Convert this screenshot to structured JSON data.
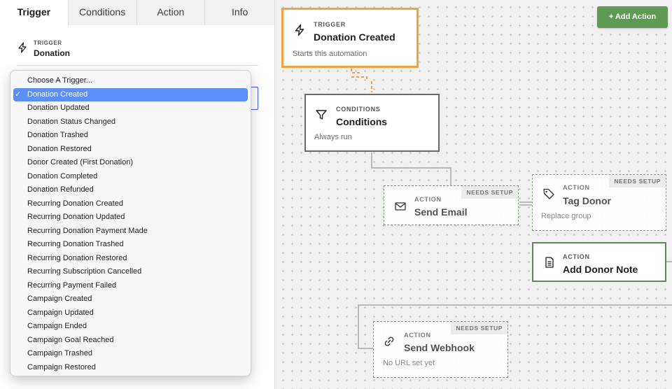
{
  "tabs": [
    {
      "label": "Trigger",
      "active": true
    },
    {
      "label": "Conditions",
      "active": false
    },
    {
      "label": "Action",
      "active": false
    },
    {
      "label": "Info",
      "active": false
    }
  ],
  "trigger_panel": {
    "kicker": "TRIGGER",
    "title": "Donation"
  },
  "dropdown": {
    "selected": "Donation Created",
    "options": [
      "Choose A Trigger...",
      "Donation Created",
      "Donation Updated",
      "Donation Status Changed",
      "Donation Trashed",
      "Donation Restored",
      "Donor Created (First Donation)",
      "Donation Completed",
      "Donation Refunded",
      "Recurring Donation Created",
      "Recurring Donation Updated",
      "Recurring Donation Payment Made",
      "Recurring Donation Trashed",
      "Recurring Donation Restored",
      "Recurring Subscription Cancelled",
      "Recurring Payment Failed",
      "Campaign Created",
      "Campaign Updated",
      "Campaign Ended",
      "Campaign Goal Reached",
      "Campaign Trashed",
      "Campaign Restored"
    ],
    "check_glyph": "✓"
  },
  "toolbar": {
    "add_action_label": "+  Add Action"
  },
  "nodes": {
    "trigger": {
      "kicker": "TRIGGER",
      "title": "Donation Created",
      "sub": "Starts this automation",
      "icon": "bolt-icon"
    },
    "conditions": {
      "kicker": "CONDITIONS",
      "title": "Conditions",
      "sub": "Always run",
      "icon": "filter-icon"
    },
    "send_email": {
      "kicker": "ACTION",
      "title": "Send Email",
      "badge": "NEEDS SETUP",
      "icon": "mail-icon"
    },
    "tag_donor": {
      "kicker": "ACTION",
      "title": "Tag Donor",
      "sub": "Replace group",
      "badge": "NEEDS SETUP",
      "icon": "tag-icon"
    },
    "add_note": {
      "kicker": "ACTION",
      "title": "Add Donor Note",
      "icon": "note-icon"
    },
    "webhook": {
      "kicker": "ACTION",
      "title": "Send Webhook",
      "sub": "No URL set yet",
      "badge": "NEEDS SETUP",
      "icon": "link-icon"
    }
  },
  "colors": {
    "trigger_border": "#f0a243",
    "add_action_bg": "#5f9a52",
    "selected_option": "#5b8ef7",
    "action_border": "#5d8a55"
  }
}
